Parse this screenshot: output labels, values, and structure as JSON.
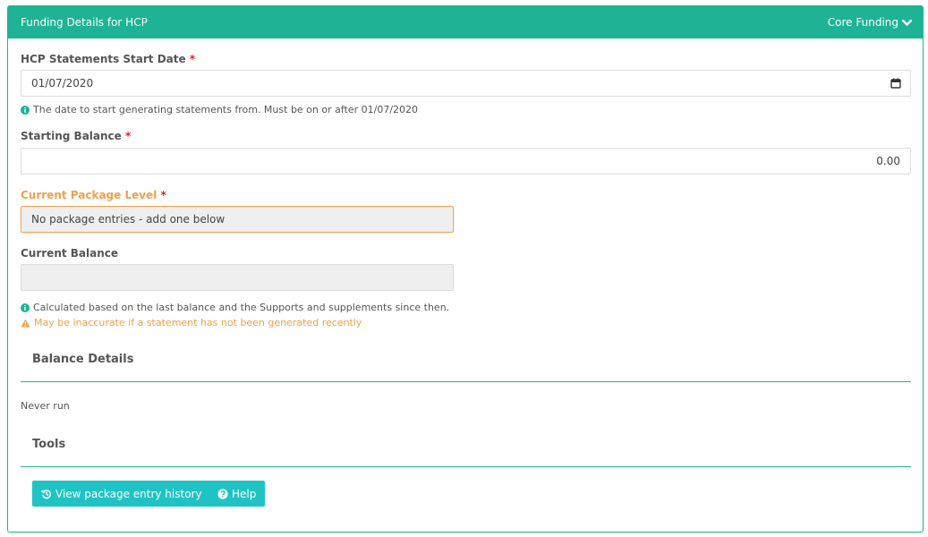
{
  "panel": {
    "title": "Funding Details for HCP",
    "right_label": "Core Funding",
    "right_icon": "chevron-down-icon"
  },
  "fields": {
    "start_date": {
      "label": "HCP Statements Start Date",
      "required_marker": "*",
      "value": "01/07/2020",
      "help": "The date to start generating statements from. Must be on or after 01/07/2020"
    },
    "starting_balance": {
      "label": "Starting Balance",
      "required_marker": "*",
      "value": "0.00"
    },
    "package_level": {
      "label": "Current Package Level",
      "required_marker": "*",
      "value": "No package entries - add one below"
    },
    "current_balance": {
      "label": "Current Balance",
      "value": "",
      "help": "Calculated based on the last balance and the Supports and supplements since then.",
      "warning": "May be inaccurate if a statement has not been generated recently"
    }
  },
  "balance_details": {
    "title": "Balance Details",
    "status": "Never run"
  },
  "tools": {
    "title": "Tools",
    "buttons": [
      {
        "label": "View package entry history",
        "icon": "history-icon"
      },
      {
        "label": "Help",
        "icon": "question-circle-icon"
      }
    ]
  },
  "colors": {
    "accent": "#1db394",
    "button": "#1fc3c3",
    "warning": "#f0a04b",
    "required": "#e02020"
  }
}
